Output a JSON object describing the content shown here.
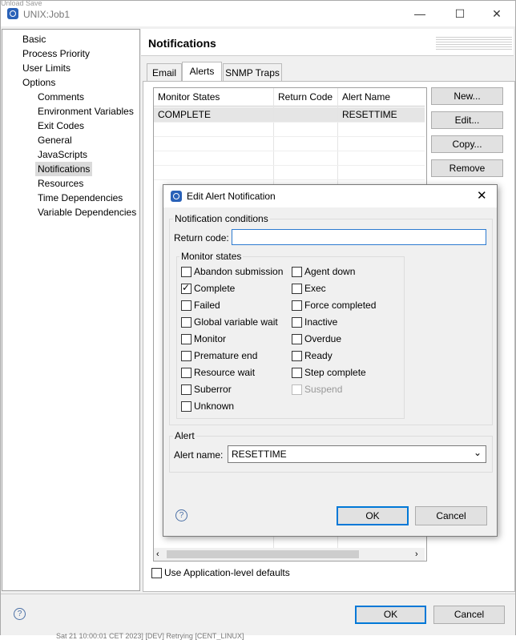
{
  "window": {
    "title": "UNIX:Job1",
    "top_strip": "Unload  Save"
  },
  "nav": {
    "items": [
      {
        "label": "Basic",
        "level": 0
      },
      {
        "label": "Process Priority",
        "level": 0
      },
      {
        "label": "User Limits",
        "level": 0
      },
      {
        "label": "Options",
        "level": 0
      },
      {
        "label": "Comments",
        "level": 1
      },
      {
        "label": "Environment Variables",
        "level": 1
      },
      {
        "label": "Exit Codes",
        "level": 1
      },
      {
        "label": "General",
        "level": 1
      },
      {
        "label": "JavaScripts",
        "level": 1
      },
      {
        "label": "Notifications",
        "level": 1,
        "selected": true
      },
      {
        "label": "Resources",
        "level": 1
      },
      {
        "label": "Time Dependencies",
        "level": 1
      },
      {
        "label": "Variable Dependencies",
        "level": 1
      }
    ]
  },
  "header": {
    "title": "Notifications"
  },
  "tabs": [
    {
      "label": "Email"
    },
    {
      "label": "Alerts",
      "active": true
    },
    {
      "label": "SNMP Traps"
    }
  ],
  "table": {
    "columns": [
      "Monitor States",
      "Return Code",
      "Alert Name"
    ],
    "rows": [
      [
        "COMPLETE",
        "",
        "RESETTIME"
      ]
    ]
  },
  "side_buttons": {
    "new": "New...",
    "edit": "Edit...",
    "copy": "Copy...",
    "remove": "Remove"
  },
  "use_defaults_label": "Use Application-level defaults",
  "dialog": {
    "title": "Edit Alert Notification",
    "conditions_group": "Notification conditions",
    "return_code_label": "Return code:",
    "return_code_value": "",
    "monitor_group": "Monitor states",
    "states_left": [
      {
        "label": "Abandon submission",
        "checked": false
      },
      {
        "label": "Complete",
        "checked": true
      },
      {
        "label": "Failed",
        "checked": false
      },
      {
        "label": "Global variable wait",
        "checked": false
      },
      {
        "label": "Monitor",
        "checked": false
      },
      {
        "label": "Premature end",
        "checked": false
      },
      {
        "label": "Resource wait",
        "checked": false
      },
      {
        "label": "Suberror",
        "checked": false
      },
      {
        "label": "Unknown",
        "checked": false
      }
    ],
    "states_right": [
      {
        "label": "Agent down",
        "checked": false
      },
      {
        "label": "Exec",
        "checked": false
      },
      {
        "label": "Force completed",
        "checked": false
      },
      {
        "label": "Inactive",
        "checked": false
      },
      {
        "label": "Overdue",
        "checked": false
      },
      {
        "label": "Ready",
        "checked": false
      },
      {
        "label": "Step complete",
        "checked": false
      },
      {
        "label": "Suspend",
        "checked": false,
        "disabled": true
      }
    ],
    "alert_group": "Alert",
    "alert_name_label": "Alert name:",
    "alert_name_value": "RESETTIME",
    "ok": "OK",
    "cancel": "Cancel"
  },
  "footer": {
    "ok": "OK",
    "cancel": "Cancel"
  },
  "background_text": "Sat 21 10:00:01 CET 2023] [DEV]   Retrying  [CENT_LINUX]"
}
